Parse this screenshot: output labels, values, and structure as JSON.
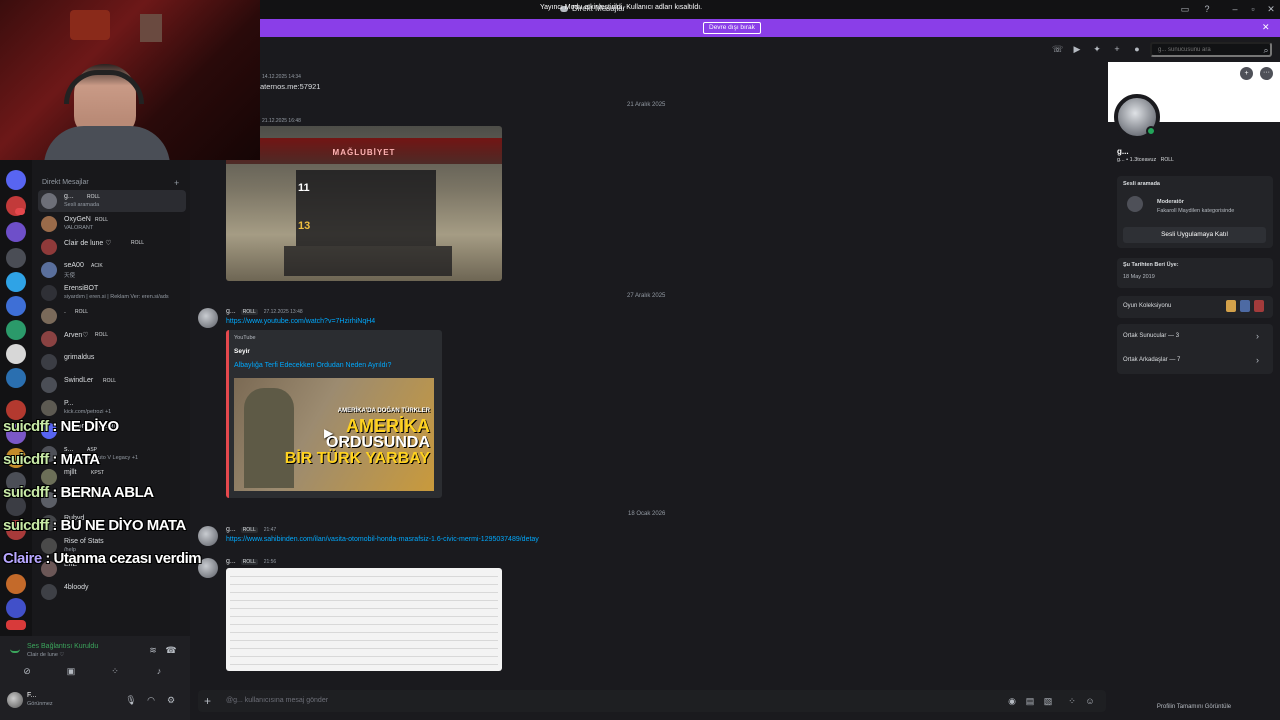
{
  "window": {
    "title": "Direkt Mesajlar"
  },
  "banner": {
    "text": "Yayıncı Modu etkinleştirildi. Kullanıcı adları kısaltıldı.",
    "button": "Devre dışı bırak"
  },
  "search": {
    "placeholder": "g... sunucusunu ara"
  },
  "sidebar": {
    "header": "Direkt Mesajlar",
    "dms": [
      {
        "name": "g...",
        "tag": "ROLL",
        "sub": "Sesli aramada"
      },
      {
        "name": "OxyGeN",
        "tag": "ROLL",
        "sub": "VALORANT"
      },
      {
        "name": "Clair de lune ♡",
        "tag": "ROLL",
        "sub": ""
      },
      {
        "name": "seA00",
        "tag": "ACIK",
        "sub": "天使"
      },
      {
        "name": "ErensiBOT",
        "tag": "",
        "sub": "siyardım | eren.si | Reklam Ver: eren.si/ads"
      },
      {
        "name": ".",
        "tag": "ROLL",
        "sub": ""
      },
      {
        "name": "Arven♡",
        "tag": "ROLL",
        "sub": ""
      },
      {
        "name": "grimaldus",
        "tag": "",
        "sub": ""
      },
      {
        "name": "SwindLer",
        "tag": "ROLL",
        "sub": ""
      },
      {
        "name": "P...",
        "tag": "",
        "sub": "kick.com/petrozi +1"
      },
      {
        "name": "Discord",
        "tag": "RESMİ",
        "sub": ""
      },
      {
        "name": "s...",
        "tag": "ASP",
        "sub": "Grand Theft Auto V Legacy +1"
      },
      {
        "name": "mjllt",
        "tag": "KPST",
        "sub": ""
      },
      {
        "name": "e320",
        "tag": "GUNS",
        "sub": ""
      },
      {
        "name": "Rubyd",
        "tag": "",
        "sub": ""
      },
      {
        "name": "Rise of Stats",
        "tag": "",
        "sub": "/help"
      },
      {
        "name": "EffE",
        "tag": "",
        "sub": ""
      },
      {
        "name": "4bloody",
        "tag": "",
        "sub": ""
      }
    ]
  },
  "voice": {
    "title": "Ses Bağlantısı Kuruldu",
    "sub": "Clair de lune ♡"
  },
  "user": {
    "name": "F...",
    "status": "Görünmez"
  },
  "overlay_chat": [
    {
      "user": "suicdff",
      "sep": " : ",
      "text": "NE DİYO"
    },
    {
      "user": "suicdff",
      "sep": " : ",
      "text": "MATA"
    },
    {
      "user": "suicdff",
      "sep": " : ",
      "text": "BERNA ABLA"
    },
    {
      "user": "suicdff",
      "sep": " : ",
      "text": "BU NE DİYO MATA"
    },
    {
      "user": "Claire",
      "sep": " : ",
      "text": "Utanma cezası verdim"
    }
  ],
  "messages": {
    "m1": {
      "time": "14.12.2025 14:34",
      "text": "aternos.me:57921"
    },
    "date1": "21 Aralık 2025",
    "m2": {
      "time": "21.12.2025 16:48"
    },
    "image1": {
      "title": "MAĞLUBİYET",
      "score_a": "11",
      "score_b": "13"
    },
    "date2": "27 Aralık 2025",
    "m3": {
      "name": "g...",
      "role": "ROLL",
      "time": "27.12.2025 13:48",
      "link": "https://www.youtube.com/watch?v=7HzirhiNqH4"
    },
    "embed": {
      "provider": "YouTube",
      "author": "Seyir",
      "title": "Albaylığa Terfi Edecekken Ordudan Neden Ayrıldı?",
      "thumb_small": "AMERİKA'DA DOĞAN TÜRKLER",
      "thumb_l1": "AMERİKA",
      "thumb_l2": "ORDUSUNDA",
      "thumb_l3": "BİR TÜRK YARBAY"
    },
    "date3": "18 Ocak 2026",
    "m4": {
      "name": "g...",
      "role": "ROLL",
      "time": "21:47",
      "link": "https://www.sahibinden.com/ilan/vasita-otomobil-honda-masrafsiz-1.6-civic-mermi-1295037489/detay"
    },
    "m5": {
      "name": "g...",
      "role": "ROLL",
      "time": "21:56"
    }
  },
  "composer": {
    "placeholder": "@g... kullanıcısına mesaj gönder"
  },
  "profile": {
    "name": "g...",
    "sub": "g... • 1.3tceavuz",
    "role": "ROLL",
    "voice_header": "Sesli aramada",
    "voice_title": "Moderatör",
    "voice_sub": "Fakaroll Maydilen kategorisinde",
    "join_button": "Sesli Uygulamaya Katıl",
    "member_since_label": "Şu Tarihten Beri Üye:",
    "member_since": "18 May 2019",
    "games": "Oyun Koleksiyonu",
    "mutual_servers": "Ortak Sunucular — 3",
    "mutual_friends": "Ortak Arkadaşlar — 7",
    "view_full": "Profilin Tamamını Görüntüle"
  },
  "colors": {
    "accent": "#8a3ee8",
    "link": "#00a8fc",
    "online": "#23a55a",
    "danger": "#e5484d"
  }
}
